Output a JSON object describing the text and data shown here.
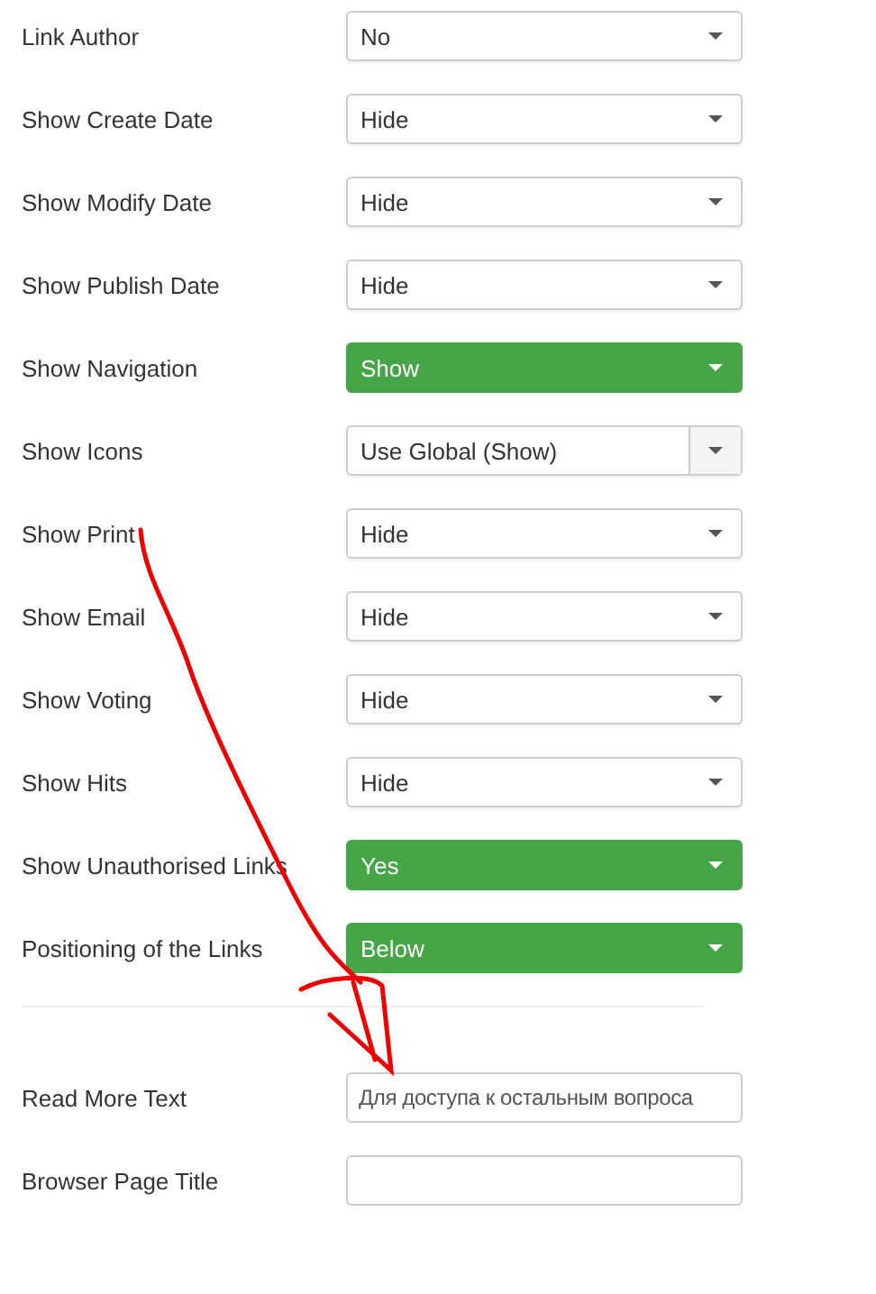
{
  "options": [
    {
      "label": "Link Author",
      "kind": "select",
      "value": "No",
      "highlighted": false
    },
    {
      "label": "Show Create Date",
      "kind": "select",
      "value": "Hide",
      "highlighted": false
    },
    {
      "label": "Show Modify Date",
      "kind": "select",
      "value": "Hide",
      "highlighted": false
    },
    {
      "label": "Show Publish Date",
      "kind": "select",
      "value": "Hide",
      "highlighted": false
    },
    {
      "label": "Show Navigation",
      "kind": "select",
      "value": "Show",
      "highlighted": true
    },
    {
      "label": "Show Icons",
      "kind": "global-select",
      "value": "Use Global (Show)",
      "highlighted": false
    },
    {
      "label": "Show Print",
      "kind": "select",
      "value": "Hide",
      "highlighted": false
    },
    {
      "label": "Show Email",
      "kind": "select",
      "value": "Hide",
      "highlighted": false
    },
    {
      "label": "Show Voting",
      "kind": "select",
      "value": "Hide",
      "highlighted": false
    },
    {
      "label": "Show Hits",
      "kind": "select",
      "value": "Hide",
      "highlighted": false
    },
    {
      "label": "Show Unauthorised Links",
      "kind": "select",
      "value": "Yes",
      "highlighted": true
    },
    {
      "label": "Positioning of the Links",
      "kind": "select",
      "value": "Below",
      "highlighted": true
    }
  ],
  "fields": [
    {
      "label": "Read More Text",
      "value": "Для доступа к остальным вопроса"
    },
    {
      "label": "Browser Page Title"
    }
  ]
}
